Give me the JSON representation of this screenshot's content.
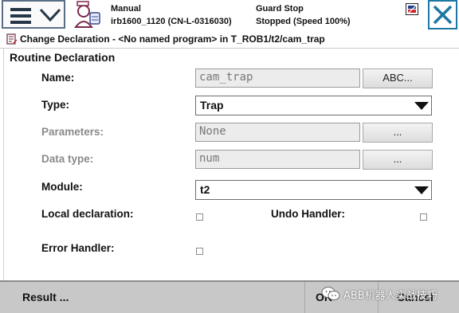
{
  "status": {
    "mode": "Manual",
    "controller": "irb1600_1120 (CN-L-0316030)",
    "motors": "Guard Stop",
    "program_state": "Stopped (Speed 100%)"
  },
  "titlebar": {
    "text": "Change Declaration - <No named program> in T_ROB1/t2/cam_trap"
  },
  "form": {
    "section_title": "Routine Declaration",
    "name_label": "Name:",
    "name_value": "cam_trap",
    "name_button": "ABC...",
    "type_label": "Type:",
    "type_value": "Trap",
    "parameters_label": "Parameters:",
    "parameters_value": "None",
    "parameters_button": "...",
    "datatype_label": "Data type:",
    "datatype_value": "num",
    "datatype_button": "...",
    "module_label": "Module:",
    "module_value": "t2",
    "local_label": "Local declaration:",
    "undo_label": "Undo Handler:",
    "error_label": "Error Handler:"
  },
  "bottombar": {
    "result": "Result ...",
    "ok": "OK",
    "cancel": "Cancel"
  },
  "watermark": {
    "text": "ABB机器人实战技巧"
  },
  "colors": {
    "accent": "#1c78a5",
    "bottom_bar": "#c8c8c8"
  }
}
